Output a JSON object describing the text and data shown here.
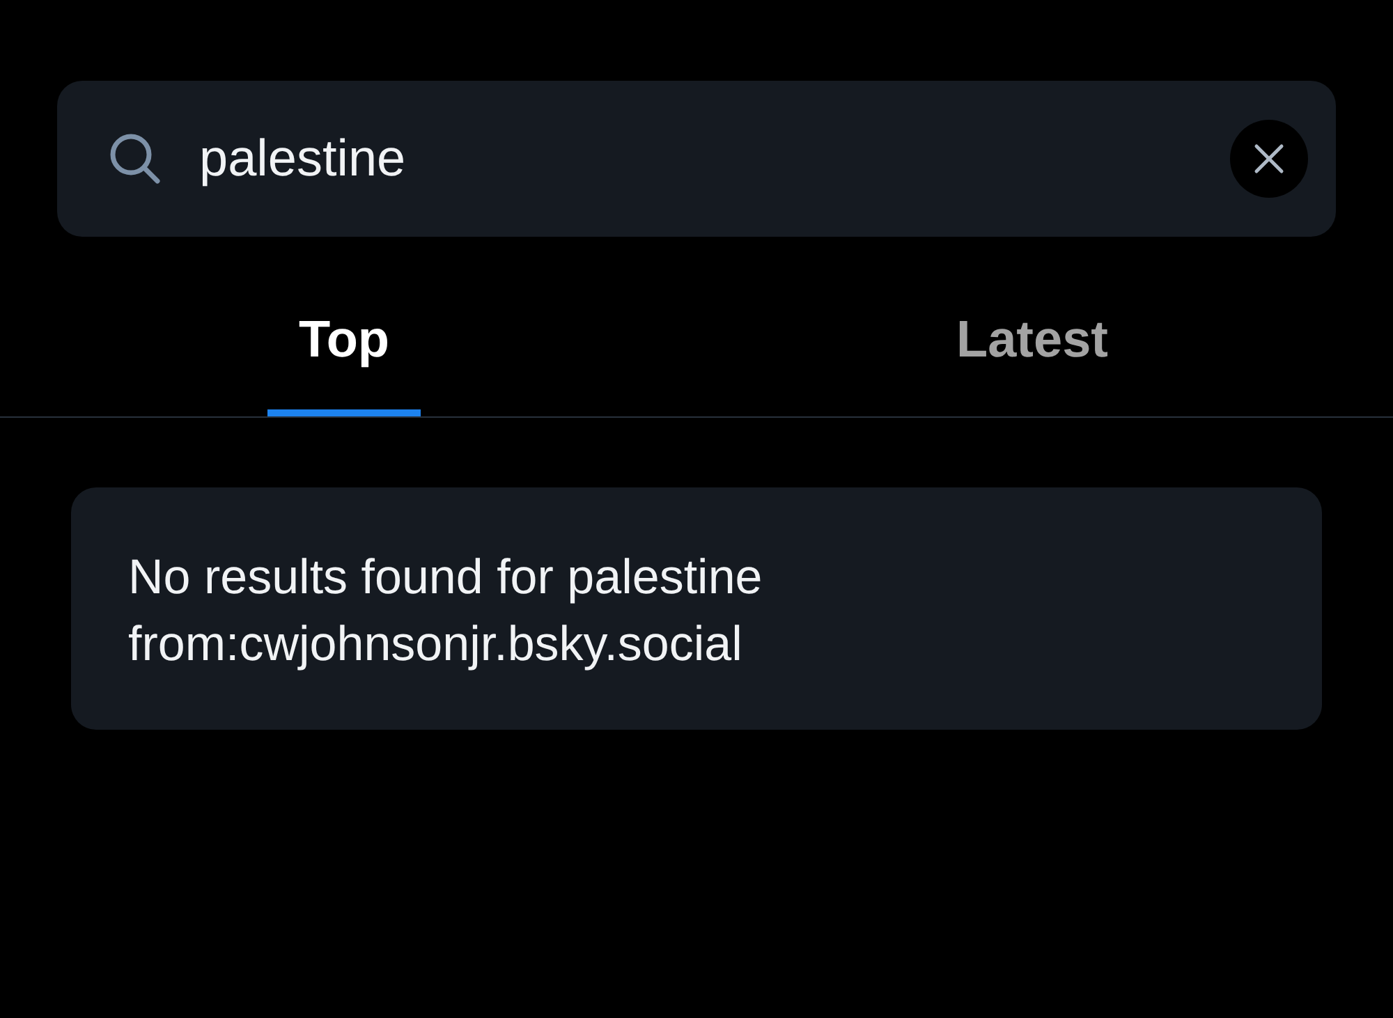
{
  "search": {
    "value": "palestine"
  },
  "tabs": [
    {
      "label": "Top",
      "selected": true
    },
    {
      "label": "Latest",
      "selected": false
    }
  ],
  "message": "No results found for palestine from:cwjohnsonjr.bsky.social"
}
